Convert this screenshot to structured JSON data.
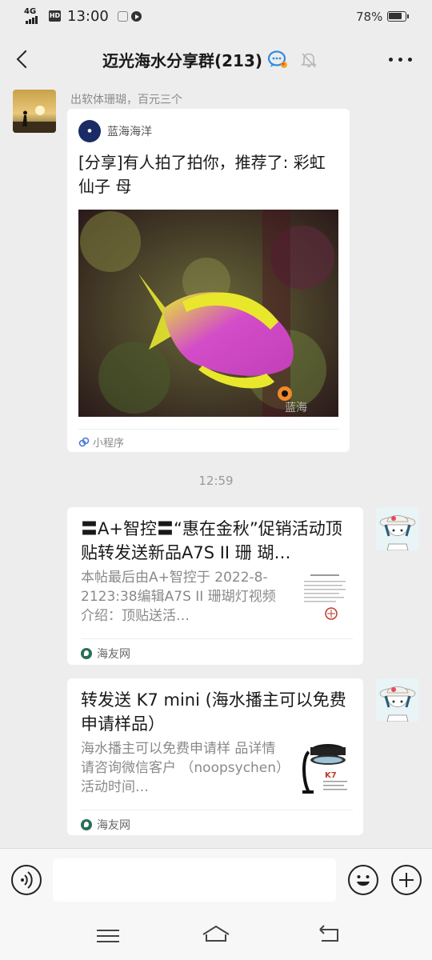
{
  "status_bar": {
    "network": "4G",
    "hd": "HD",
    "time": "13:00",
    "battery_percent": "78%"
  },
  "header": {
    "title": "迈光海水分享群(213)",
    "back_icon": "chevron-left-icon",
    "mini_program_icon": "chat-bubble-icon",
    "mute_icon": "bell-muted-icon",
    "more_icon": "more-dots-icon"
  },
  "messages": [
    {
      "type": "mini_program",
      "sender": "出软体珊瑚，百元三个",
      "source_name": "蓝海海洋",
      "title": "[分享]有人拍了拍你，推荐了: 彩虹仙子 母",
      "image_watermark": "蓝海",
      "footer_label": "小程序"
    },
    {
      "type": "time",
      "text": "12:59"
    },
    {
      "type": "article",
      "title": "〓A+智控〓“惠在金秋”促销活动顶贴转发送新品A7S II 珊 瑚…",
      "description": "本帖最后由A+智控于 2022-8-2123:38编辑A7S II 珊瑚灯视频介绍：顶贴送活…",
      "source": "海友网"
    },
    {
      "type": "article",
      "title": "转发送 K7 mini (海水播主可以免费申请样品）",
      "description": "海水播主可以免费申请样 品详情请咨询微信客户 （noopsychen）活动时间…",
      "thumb_text": "K7",
      "source": "海友网"
    }
  ],
  "input_bar": {
    "voice_icon": "voice-icon",
    "placeholder": "",
    "emoji_icon": "emoji-icon",
    "plus_icon": "plus-icon"
  },
  "system_nav": {
    "menu_icon": "menu-icon",
    "home_icon": "home-icon",
    "back_icon": "back-icon"
  }
}
